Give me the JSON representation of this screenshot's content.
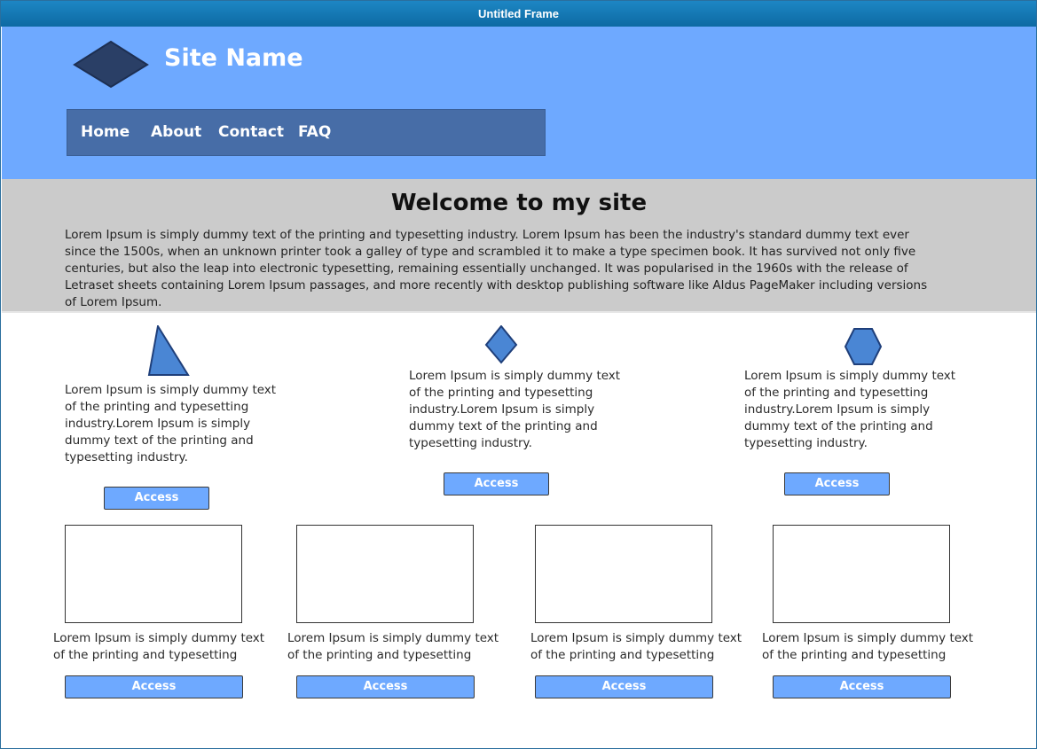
{
  "window": {
    "title": "Untitled Frame"
  },
  "header": {
    "site_name": "Site Name",
    "logo_icon": "diamond-icon",
    "nav": [
      {
        "label": "Home"
      },
      {
        "label": "About"
      },
      {
        "label": "Contact"
      },
      {
        "label": "FAQ"
      }
    ],
    "colors": {
      "header_bg": "#6ea9ff",
      "nav_bg": "#476da7",
      "logo": "#2a3f66"
    }
  },
  "hero": {
    "title": "Welcome to my site",
    "text": "Lorem Ipsum is simply dummy text of the printing and typesetting industry. Lorem Ipsum has been the industry's standard dummy text ever since the 1500s, when an unknown printer took a galley of type and scrambled it to make a type specimen book. It has survived not only five centuries, but also the leap into electronic typesetting, remaining essentially unchanged. It was popularised in the 1960s with the release of Letraset sheets containing Lorem Ipsum passages, and more recently with desktop publishing software like Aldus PageMaker including versions of Lorem Ipsum."
  },
  "features": [
    {
      "icon": "triangle-icon",
      "text": "Lorem Ipsum is simply dummy text of the printing and typesetting industry.Lorem Ipsum is simply dummy text of the printing and typesetting industry.",
      "button": "Access"
    },
    {
      "icon": "diamond-icon",
      "text": "Lorem Ipsum is simply dummy text of the printing and typesetting industry.Lorem Ipsum is simply dummy text of the printing and typesetting industry.",
      "button": "Access"
    },
    {
      "icon": "hexagon-icon",
      "text": "Lorem Ipsum is simply dummy text of the printing and typesetting industry.Lorem Ipsum is simply dummy text of the printing and typesetting industry.",
      "button": "Access"
    }
  ],
  "cards": [
    {
      "caption": "Lorem Ipsum is simply dummy text of the printing and typesetting",
      "button": "Access"
    },
    {
      "caption": "Lorem Ipsum is simply dummy text of the printing and typesetting",
      "button": "Access"
    },
    {
      "caption": "Lorem Ipsum is simply dummy text of the printing and typesetting",
      "button": "Access"
    },
    {
      "caption": "Lorem Ipsum is simply dummy text of the printing and typesetting",
      "button": "Access"
    }
  ],
  "colors": {
    "accent": "#6ea9ff",
    "icon_fill": "#4a86d4",
    "hero_bg": "#cbcbcb"
  }
}
